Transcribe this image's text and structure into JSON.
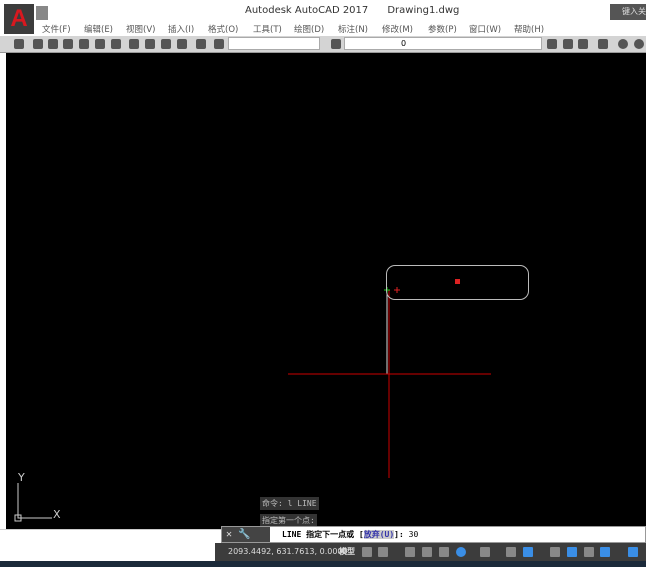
{
  "app": {
    "title": "Autodesk AutoCAD 2017",
    "document": "Drawing1.dwg",
    "search_placeholder": "键入关"
  },
  "menu": [
    "文件(F)",
    "编辑(E)",
    "视图(V)",
    "插入(I)",
    "格式(O)",
    "工具(T)",
    "绘图(D)",
    "标注(N)",
    "修改(M)",
    "参数(P)",
    "窗口(W)",
    "帮助(H)"
  ],
  "toolbar": {
    "layer_value": "0"
  },
  "history": [
    "命令: l LINE",
    "指定第一个点:"
  ],
  "command": {
    "prefix": "LINE 指定下一点或 [",
    "option": "放弃(U)",
    "suffix": "]:",
    "input": "30"
  },
  "status": {
    "coords": "2093.4492, 631.7613, 0.0000",
    "model": "模型"
  },
  "ucs": {
    "x": "X",
    "y": "Y"
  },
  "colors": {
    "canvas": "#000000",
    "crosshair": "#cc0000",
    "accent": "#d8181f"
  }
}
